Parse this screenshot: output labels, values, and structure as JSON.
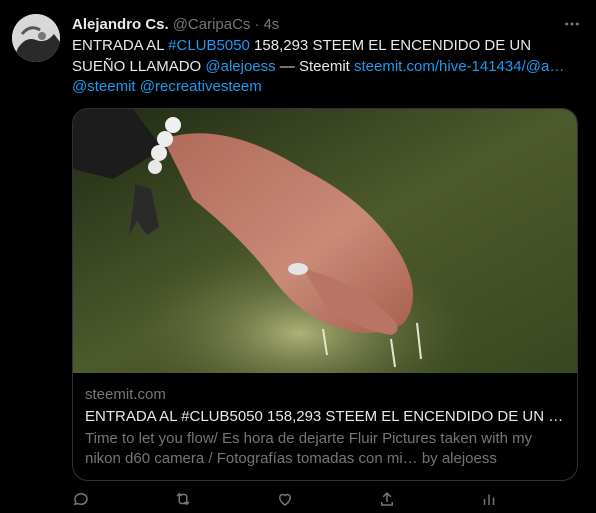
{
  "tweet": {
    "author_name": "Alejandro Cs.",
    "author_handle": "@CaripaCs",
    "separator": "·",
    "time": "4s",
    "text": {
      "part1": "ENTRADA AL ",
      "hashtag": "#CLUB5050",
      "part2": " 158,293 STEEM EL ENCENDIDO DE UN SUEÑO LLAMADO ",
      "mention1": "@alejoess",
      "part3": " — Steemit ",
      "url": "steemit.com/hive-141434/@a…",
      "part4": " ",
      "mention2": "@steemit",
      "part5": " ",
      "mention3": "@recreativesteem"
    }
  },
  "card": {
    "domain": "steemit.com",
    "title": "ENTRADA AL #CLUB5050 158,293 STEEM EL ENCENDIDO DE UN S…",
    "description": "Time to let you flow/ Es hora de dejarte Fluir Pictures taken with my nikon d60 camera / Fotografías tomadas con mi… by alejoess"
  },
  "icons": {
    "more": "more-icon",
    "reply": "reply-icon",
    "retweet": "retweet-icon",
    "like": "like-icon",
    "share": "share-icon",
    "analytics": "analytics-icon"
  },
  "colors": {
    "background": "#000000",
    "text": "#e7e9ea",
    "muted": "#71767b",
    "link": "#1d9bf0",
    "border": "#2f3336"
  }
}
